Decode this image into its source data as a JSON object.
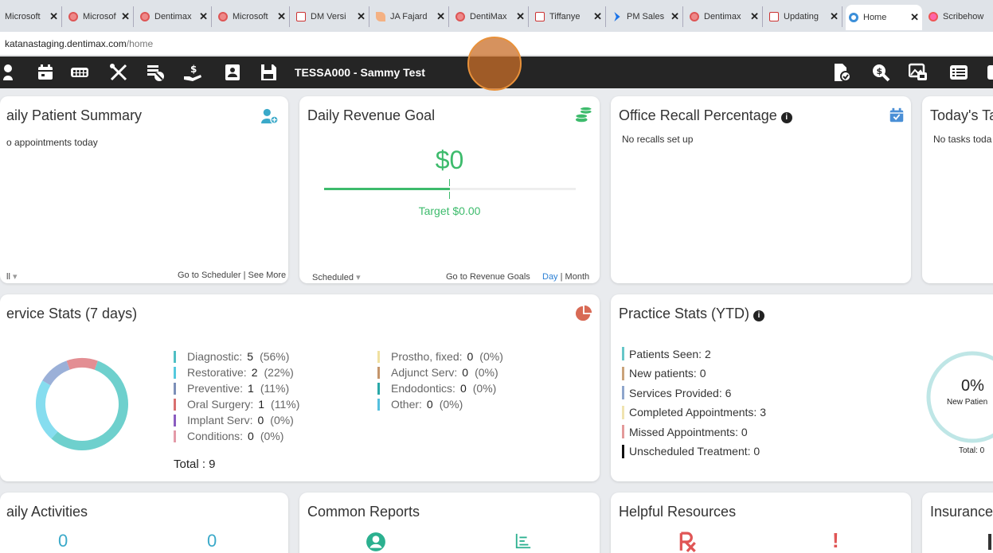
{
  "browser": {
    "tabs": [
      {
        "title": "Microsoft",
        "icon": "red",
        "active": false
      },
      {
        "title": "Microsoft",
        "icon": "red",
        "active": false
      },
      {
        "title": "Dentimax",
        "icon": "red",
        "active": false
      },
      {
        "title": "Microsoft",
        "icon": "red",
        "active": false
      },
      {
        "title": "DM Versi",
        "icon": "pdf",
        "active": false
      },
      {
        "title": "JA Fajard",
        "icon": "leaf",
        "active": false
      },
      {
        "title": "DentiMax",
        "icon": "red",
        "active": false
      },
      {
        "title": "Tiffanye",
        "icon": "pdf",
        "active": false
      },
      {
        "title": "PM Sales",
        "icon": "blue",
        "active": false
      },
      {
        "title": "Dentimax",
        "icon": "red",
        "active": false
      },
      {
        "title": "Updating",
        "icon": "pdf",
        "active": false
      },
      {
        "title": "Home",
        "icon": "ring",
        "active": true
      },
      {
        "title": "Scribehow",
        "icon": "orange",
        "active": false
      }
    ],
    "close_glyph": "✕",
    "url_host": "katanastaging.dentimax.com",
    "url_path": "/home"
  },
  "navbar": {
    "patient": "TESSA000 - Sammy Test"
  },
  "daily_patient": {
    "title": "aily Patient Summary",
    "message": "o appointments today",
    "filter": "ll",
    "link_scheduler": "Go to Scheduler",
    "separator": "|",
    "link_more": "See More"
  },
  "revenue": {
    "title": "Daily Revenue Goal",
    "amount": "$0",
    "target": "Target $0.00",
    "progress": 0.5,
    "filter": "Scheduled",
    "link_goals": "Go to Revenue Goals",
    "period_day": "Day",
    "separator": "|",
    "period_month": "Month"
  },
  "recall": {
    "title": "Office Recall Percentage",
    "message": "No recalls set up"
  },
  "tasks": {
    "title": "Today's Ta",
    "message": "No tasks toda"
  },
  "service_stats": {
    "title": "ervice Stats (7 days)",
    "col1": [
      {
        "label": "Diagnostic:",
        "count": "5",
        "pct": "(56%)",
        "color": "#4fbfc4"
      },
      {
        "label": "Restorative:",
        "count": "2",
        "pct": "(22%)",
        "color": "#55c9de"
      },
      {
        "label": "Preventive:",
        "count": "1",
        "pct": "(11%)",
        "color": "#7c8fb8"
      },
      {
        "label": "Oral Surgery:",
        "count": "1",
        "pct": "(11%)",
        "color": "#d86f6f"
      },
      {
        "label": "Implant Serv:",
        "count": "0",
        "pct": "(0%)",
        "color": "#8a5cc0"
      },
      {
        "label": "Conditions:",
        "count": "0",
        "pct": "(0%)",
        "color": "#e49aa8"
      }
    ],
    "col2": [
      {
        "label": "Prostho, fixed:",
        "count": "0",
        "pct": "(0%)",
        "color": "#f0e0a0"
      },
      {
        "label": "Adjunct Serv:",
        "count": "0",
        "pct": "(0%)",
        "color": "#c4956b"
      },
      {
        "label": "Endodontics:",
        "count": "0",
        "pct": "(0%)",
        "color": "#2aa8a8"
      },
      {
        "label": "Other:",
        "count": "0",
        "pct": "(0%)",
        "color": "#55c0de"
      }
    ],
    "total": "Total : 9",
    "donut": [
      {
        "value": 56,
        "color": "#6ed0cd"
      },
      {
        "value": 22,
        "color": "#86ddef"
      },
      {
        "value": 11,
        "color": "#9bb0d8"
      },
      {
        "value": 11,
        "color": "#e38e93"
      }
    ]
  },
  "practice_stats": {
    "title": "Practice Stats (YTD)",
    "items": [
      {
        "label": "Patients Seen: 2",
        "color": "#66c6c8"
      },
      {
        "label": "New patients: 0",
        "color": "#caa37a"
      },
      {
        "label": "Services Provided: 6",
        "color": "#8fa6cc"
      },
      {
        "label": "Completed Appointments: 3",
        "color": "#f0e3b0"
      },
      {
        "label": "Missed Appointments: 0",
        "color": "#e39a9a"
      },
      {
        "label": "Unscheduled Treatment: 0",
        "color": "#111111"
      }
    ],
    "ring_pct": "0%",
    "ring_label": "New Patien",
    "ring_total": "Total: 0"
  },
  "daily_activities": {
    "title": "aily Activities",
    "value1": "0",
    "value2": "0"
  },
  "common_reports": {
    "title": "Common Reports"
  },
  "helpful": {
    "title": "Helpful Resources",
    "alert": "!"
  },
  "insurance": {
    "title": "Insurance"
  },
  "colors": {
    "accent_teal": "#3aa9c9",
    "green": "#3dbb6c",
    "nav_bg": "#252525",
    "cursor": "#e8913a"
  }
}
